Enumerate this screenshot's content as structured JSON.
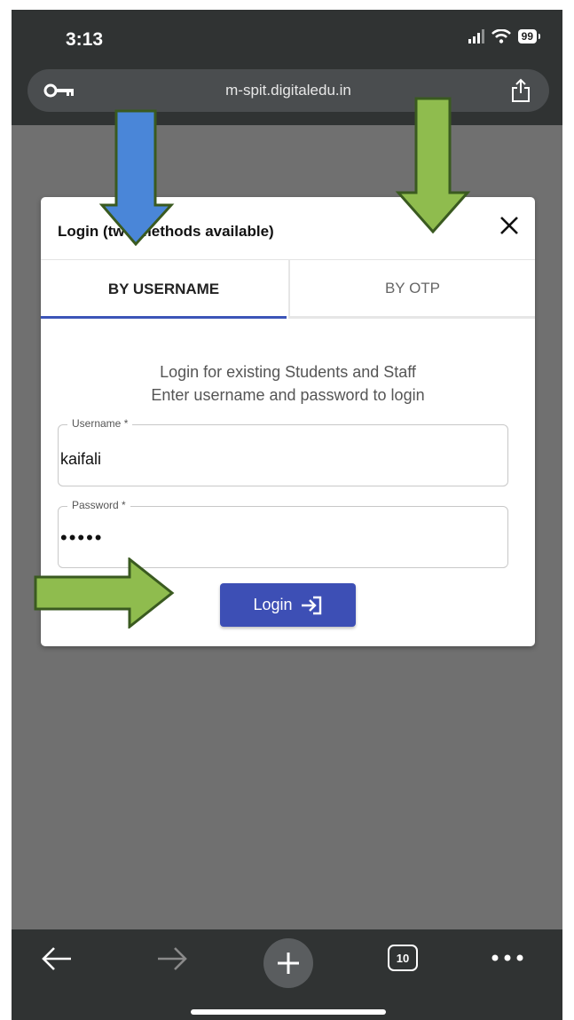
{
  "status_bar": {
    "time": "3:13",
    "battery": "99"
  },
  "browser": {
    "url": "m-spit.digitaledu.in"
  },
  "modal": {
    "title": "Login (two methods available)",
    "tabs": [
      {
        "label": "BY USERNAME",
        "selected": true
      },
      {
        "label": "BY OTP",
        "selected": false
      }
    ],
    "intro_line1": "Login for existing Students and Staff",
    "intro_line2": "Enter username and password to login",
    "username_label": "Username *",
    "username_value": "kaifali",
    "password_label": "Password *",
    "password_value": "•••••",
    "login_button_label": "Login"
  },
  "bottom_toolbar": {
    "tab_count": "10"
  },
  "colors": {
    "accent": "#3d4fb5",
    "arrow_green": "#8fbc4e",
    "arrow_blue": "#4a86d8"
  },
  "icons": [
    "key-icon",
    "share-icon",
    "close-icon",
    "login-icon",
    "back-arrow-icon",
    "forward-arrow-icon",
    "plus-icon",
    "more-icon"
  ]
}
